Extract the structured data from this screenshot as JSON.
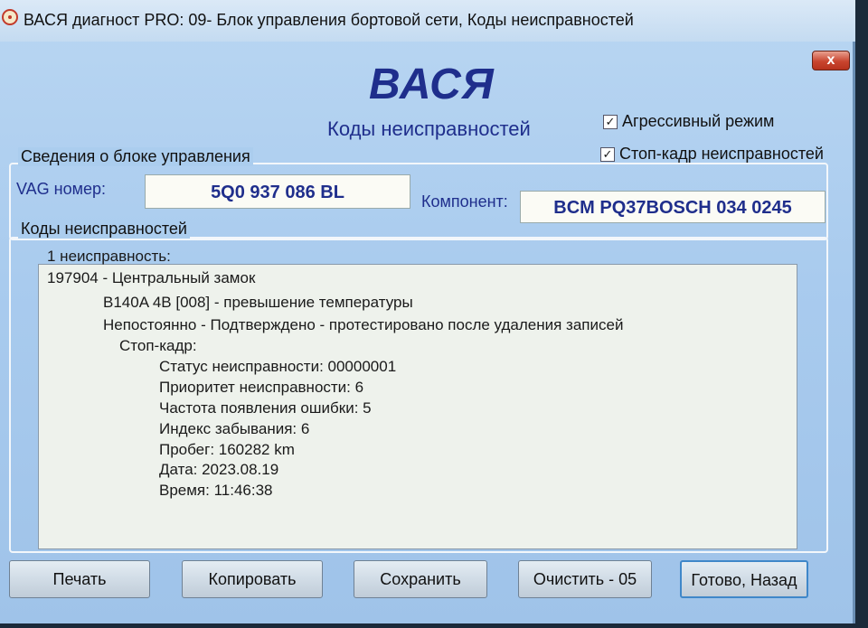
{
  "window": {
    "title": "ВАСЯ диагност PRO: 09- Блок управления бортовой сети,  Коды неисправностей",
    "close_label": "x"
  },
  "header": {
    "logo": "ВАСЯ",
    "subtitle": "Коды неисправностей"
  },
  "options": {
    "aggressive": {
      "label": "Агрессивный режим",
      "checked": true,
      "mark": "✓"
    },
    "freeze_frame": {
      "label": "Стоп-кадр неисправностей",
      "checked": true,
      "mark": "✓"
    }
  },
  "control_unit": {
    "legend": "Сведения о блоке управления",
    "vag_label": "VAG номер:",
    "vag_value": "5Q0 937 086 BL",
    "component_label": "Компонент:",
    "component_value": "BCM PQ37BOSCH 034 0245"
  },
  "faults": {
    "legend": "Коды неисправностей",
    "lines": [
      "1 неисправность:",
      "197904 - Центральный замок",
      "B140A 4B [008] - превышение температуры",
      "Непостоянно - Подтверждено - протестировано после удаления записей",
      "Стоп-кадр:",
      "Статус неисправности: 00000001",
      "Приоритет неисправности: 6",
      "Частота появления ошибки: 5",
      "Индекс забывания: 6",
      "Пробег: 160282 km",
      "Дата: 2023.08.19",
      "Время: 11:46:38"
    ]
  },
  "buttons": {
    "print": "Печать",
    "copy": "Копировать",
    "save": "Сохранить",
    "clear": "Очистить - 05",
    "done": "Готово, Назад"
  }
}
